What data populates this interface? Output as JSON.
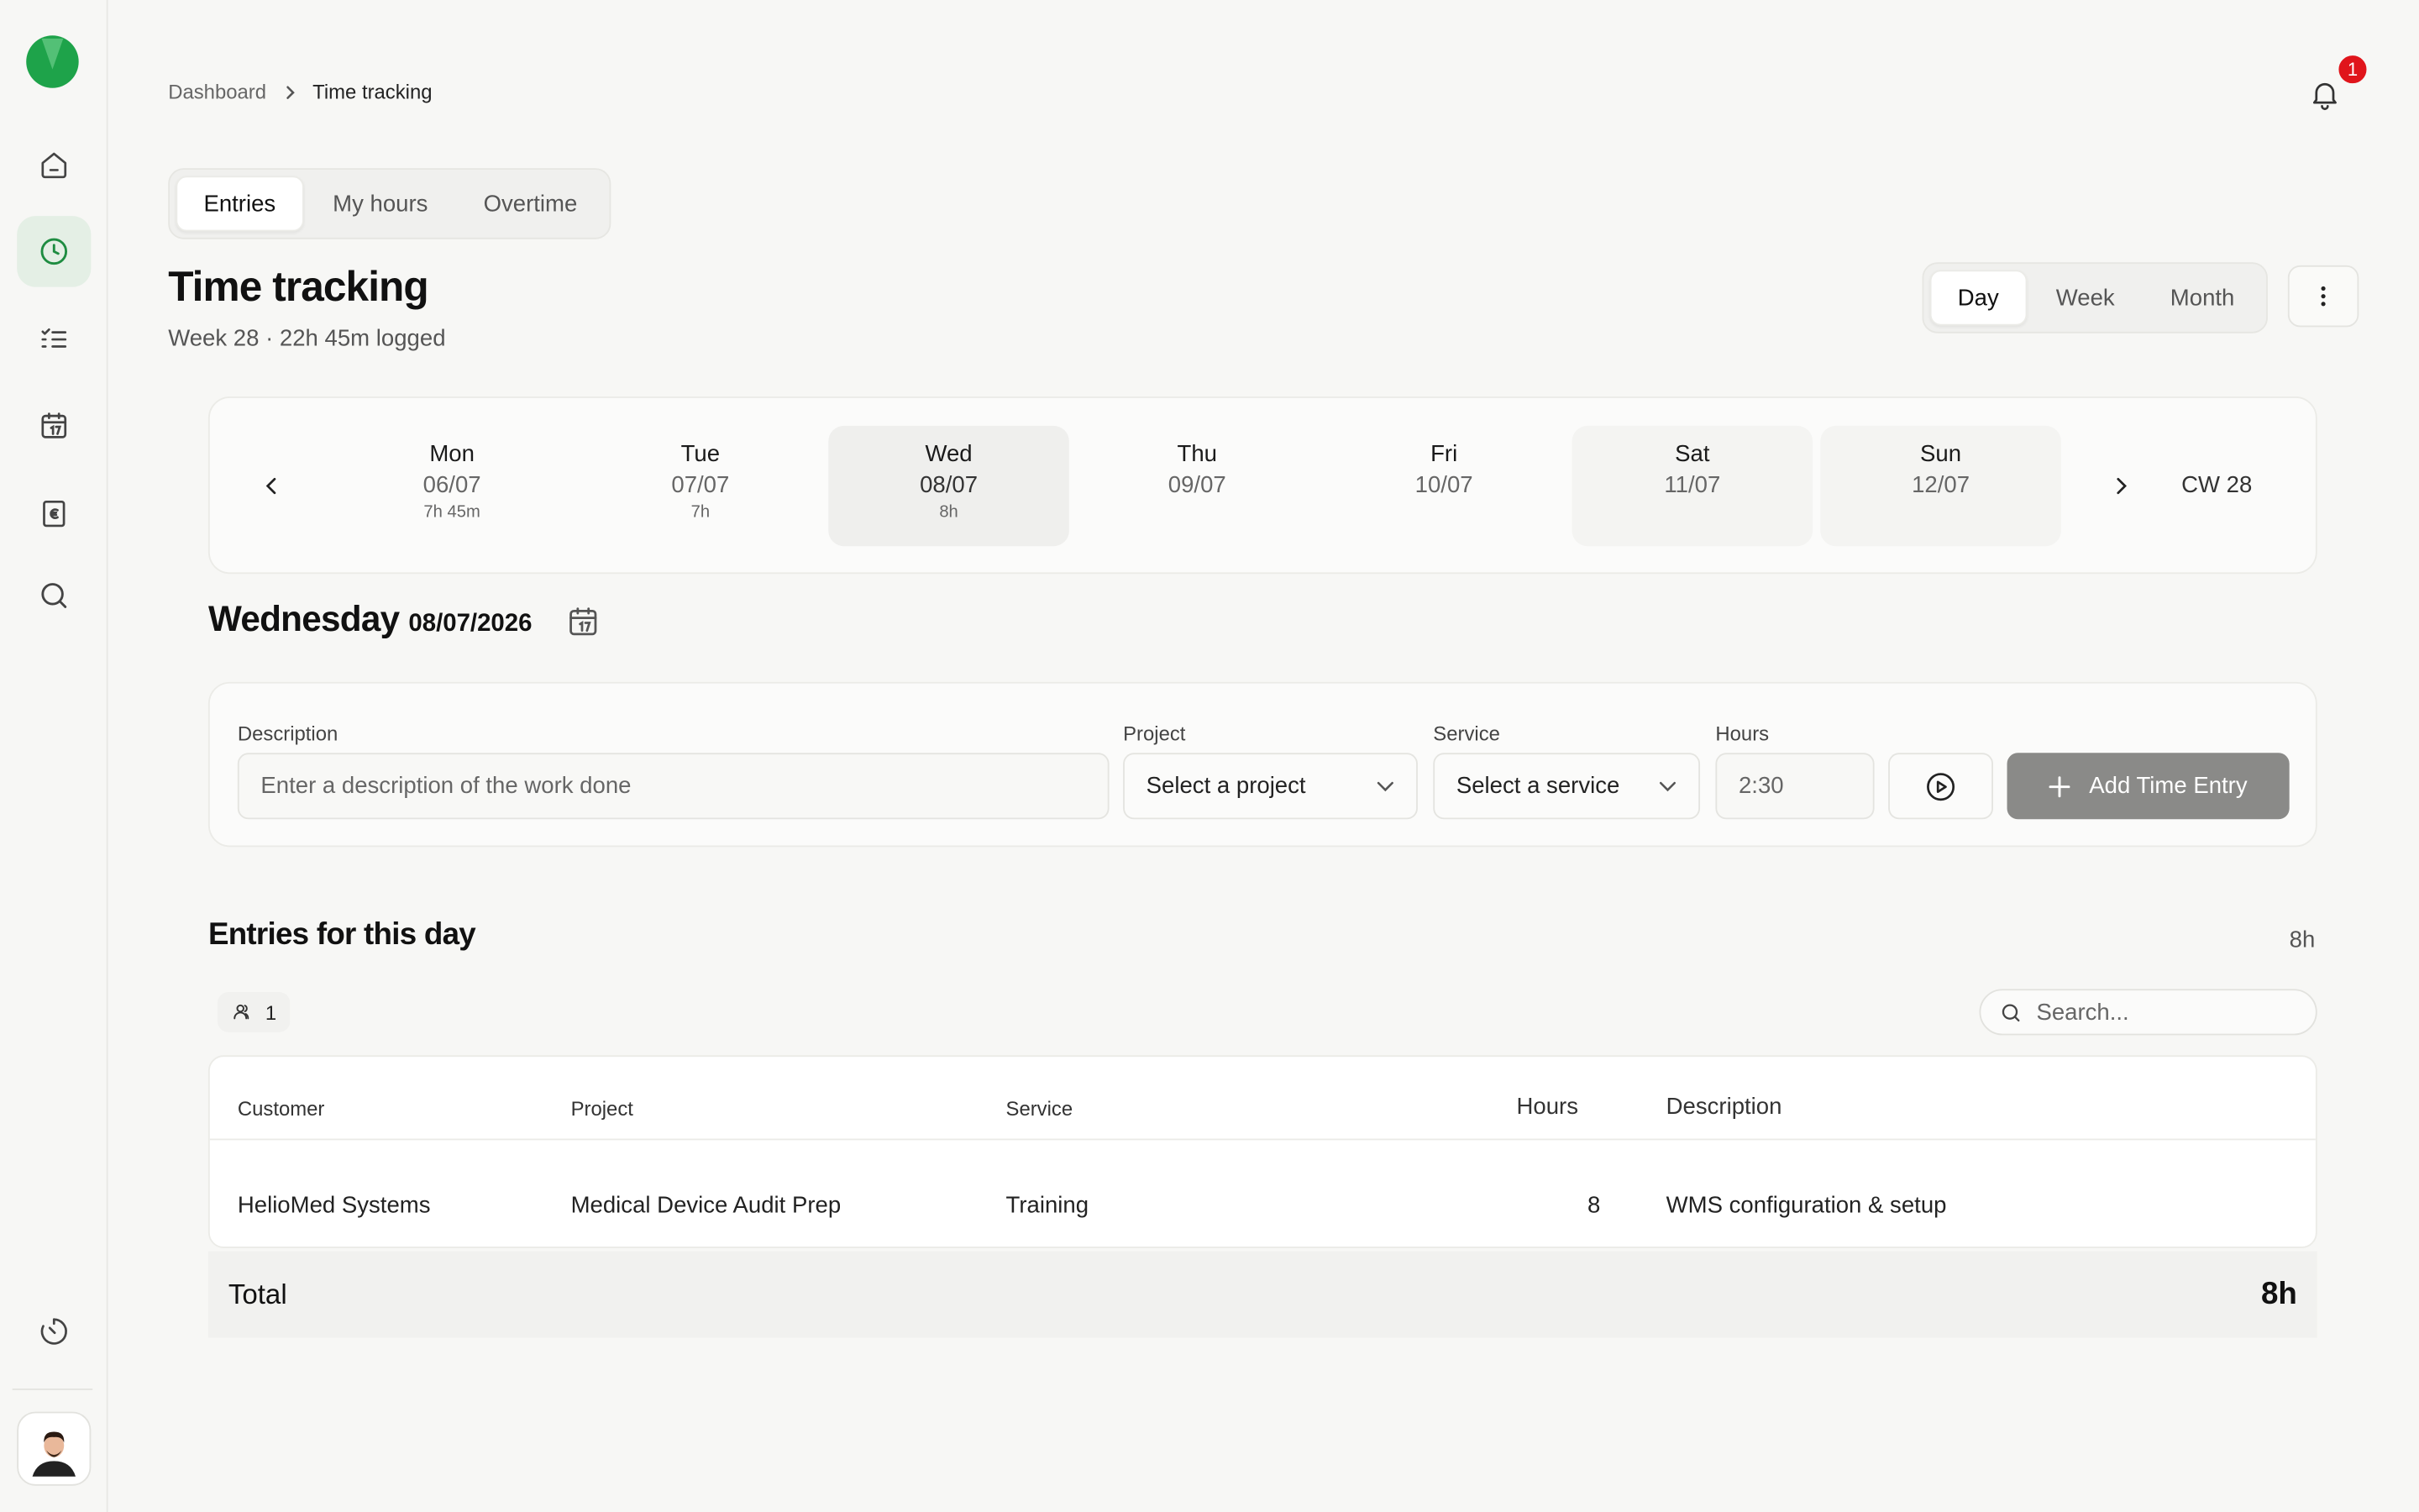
{
  "breadcrumb": {
    "home": "Dashboard",
    "current": "Time tracking"
  },
  "notifications": {
    "count": "1"
  },
  "top_tabs": [
    {
      "label": "Entries",
      "active": true
    },
    {
      "label": "My hours",
      "active": false
    },
    {
      "label": "Overtime",
      "active": false
    }
  ],
  "header": {
    "title": "Time tracking",
    "subtitle": "Week 28 · 22h 45m logged"
  },
  "view_tabs": [
    {
      "label": "Day",
      "active": true
    },
    {
      "label": "Week",
      "active": false
    },
    {
      "label": "Month",
      "active": false
    }
  ],
  "week": {
    "days": [
      {
        "name": "Mon",
        "date": "06/07",
        "hours": "7h 45m"
      },
      {
        "name": "Tue",
        "date": "07/07",
        "hours": "7h"
      },
      {
        "name": "Wed",
        "date": "08/07",
        "hours": "8h"
      },
      {
        "name": "Thu",
        "date": "09/07",
        "hours": ""
      },
      {
        "name": "Fri",
        "date": "10/07",
        "hours": ""
      },
      {
        "name": "Sat",
        "date": "11/07",
        "hours": ""
      },
      {
        "name": "Sun",
        "date": "12/07",
        "hours": ""
      }
    ],
    "selected_index": 2,
    "calendar_week": "CW 28"
  },
  "day_heading": {
    "weekday": "Wednesday",
    "date": "08/07/2026"
  },
  "entry_form": {
    "description_label": "Description",
    "description_placeholder": "Enter a description of the work done",
    "project_label": "Project",
    "project_value": "Select a project",
    "service_label": "Service",
    "service_value": "Select a service",
    "hours_label": "Hours",
    "hours_value": "2:30",
    "add_label": "Add Time Entry"
  },
  "entries": {
    "title": "Entries for this day",
    "total_hours": "8h",
    "filter_count": "1",
    "search_placeholder": "Search...",
    "columns": [
      "Customer",
      "Project",
      "Service",
      "Hours",
      "Description"
    ],
    "rows": [
      {
        "customer": "HelioMed Systems",
        "project": "Medical Device Audit Prep",
        "service": "Training",
        "hours": "8",
        "description": "WMS configuration & setup"
      }
    ],
    "total_label": "Total",
    "total_value": "8h"
  },
  "colors": {
    "brand": "#1ea34a",
    "active_nav": "#e4efe5",
    "badge": "#e0151b",
    "button_disabled": "#8a8a88"
  },
  "icons": [
    "logo-icon",
    "home-icon",
    "clock-icon",
    "checklist-icon",
    "calendar-icon",
    "invoice-icon",
    "search-icon",
    "timer-icon",
    "bell-icon",
    "more-vertical-icon",
    "chevron-left-icon",
    "chevron-right-icon",
    "chevron-down-icon",
    "play-icon",
    "plus-icon",
    "users-icon"
  ]
}
